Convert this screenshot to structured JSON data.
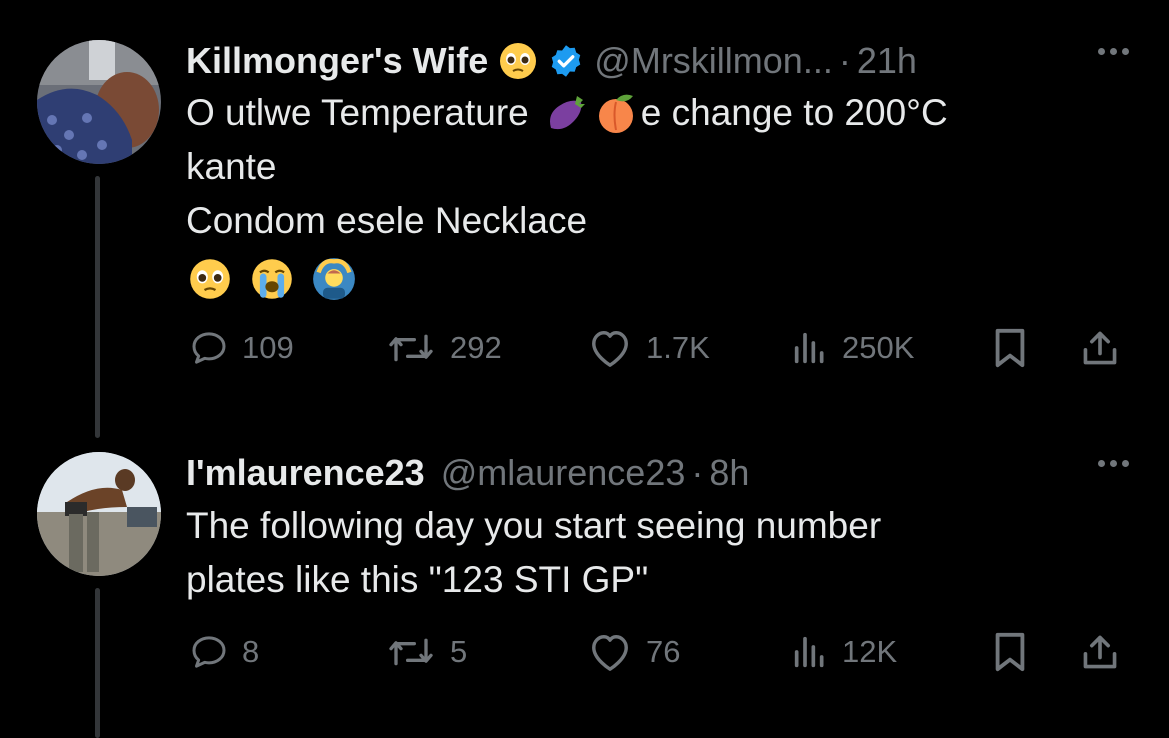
{
  "tweets": [
    {
      "name": "Killmonger's Wife",
      "name_emoji": "pleading-face",
      "verified": true,
      "handle": "@Mrskillmon...",
      "separator": "·",
      "time": "21h",
      "body": {
        "line1_a": "O utlwe Temperature",
        "line1_emojis": [
          "eggplant",
          "peach"
        ],
        "line1_b": "e change to 200°C",
        "line2": "kante",
        "line3": "Condom esele Necklace",
        "line4_emojis": [
          "pleading-face",
          "loudly-crying-face",
          "person-gesturing-ok"
        ]
      },
      "actions": {
        "replies": "109",
        "reposts": "292",
        "likes": "1.7K",
        "views": "250K"
      }
    },
    {
      "name": "I'mlaurence23",
      "handle": "@mlaurence23",
      "separator": "·",
      "time": "8h",
      "body": {
        "line1": "The following day you start seeing number",
        "line2": "plates like this \"123 STI GP\""
      },
      "actions": {
        "replies": "8",
        "reposts": "5",
        "likes": "76",
        "views": "12K"
      }
    }
  ],
  "colors": {
    "background": "#000000",
    "text": "#e7e9ea",
    "secondary": "#71767b",
    "verified_blue": "#1d9bf0",
    "thread_line": "#333639"
  }
}
